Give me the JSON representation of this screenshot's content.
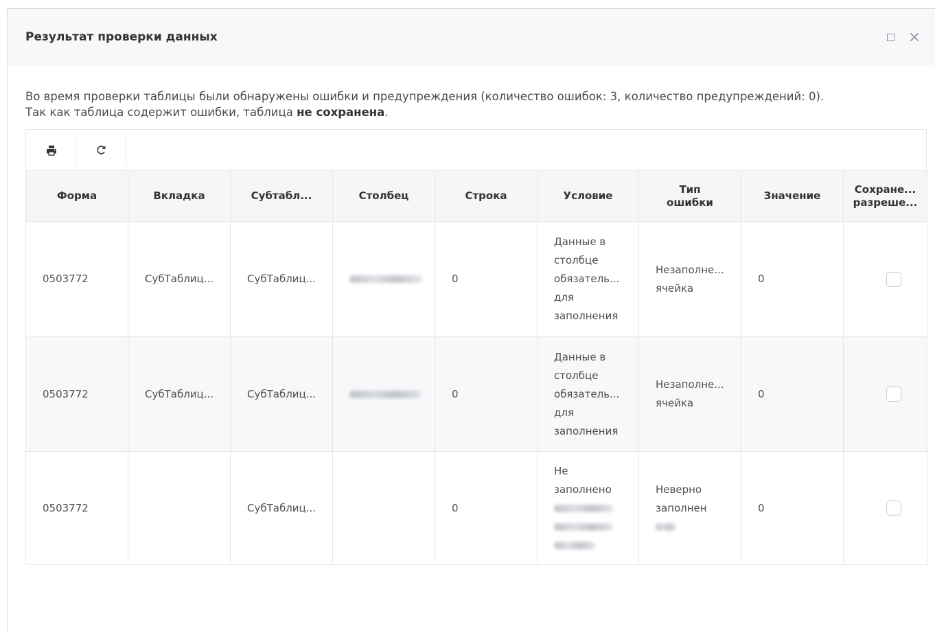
{
  "dialog": {
    "title": "Результат проверки данных",
    "maximize_icon": "maximize-icon",
    "close_icon": "close-icon"
  },
  "message": {
    "line1": "Во время проверки таблицы были обнаружены ошибки и предупреждения (количество ошибок: 3, количество предупреждений: 0).",
    "line2_text": "Так как таблица содержит ошибки, таблица ",
    "line2_bold": "не сохранена",
    "line2_end": "."
  },
  "toolbar": {
    "print_icon": "print-icon",
    "refresh_icon": "refresh-icon"
  },
  "table": {
    "columns": [
      "Форма",
      "Вкладка",
      "Субтабл...",
      "Столбец",
      "Строка",
      "Условие",
      "Тип\nошибки",
      "Значение",
      "Сохране...\nразреше..."
    ],
    "rows": [
      {
        "form": "0503772",
        "tab": "СубТаблиц...",
        "subtable": "СубТаблиц...",
        "row": "0",
        "condition": "Данные в\nстолбце\nобязатель...\nдля\nзаполнения",
        "error_type": "Незаполне...\nячейка",
        "value": "0",
        "save_allowed": false
      },
      {
        "form": "0503772",
        "tab": "СубТаблиц...",
        "subtable": "СубТаблиц...",
        "row": "0",
        "condition": "Данные в\nстолбце\nобязатель...\nдля\nзаполнения",
        "error_type": "Незаполне...\nячейка",
        "value": "0",
        "save_allowed": false
      },
      {
        "form": "0503772",
        "tab": "",
        "subtable": "СубТаблиц...",
        "column": "",
        "row": "0",
        "condition": "Не\nзаполнено",
        "error_type": "Неверно\nзаполнен",
        "value": "0",
        "save_allowed": false
      }
    ]
  },
  "colors": {
    "dialog_header_bg": "#f7f8fa",
    "table_header_bg": "#f5f6f8",
    "row_alt_bg": "#f7f8fa",
    "border": "#e3e6ea",
    "text": "#4a4a4a",
    "title": "#333333",
    "icon": "#8a8f98"
  }
}
